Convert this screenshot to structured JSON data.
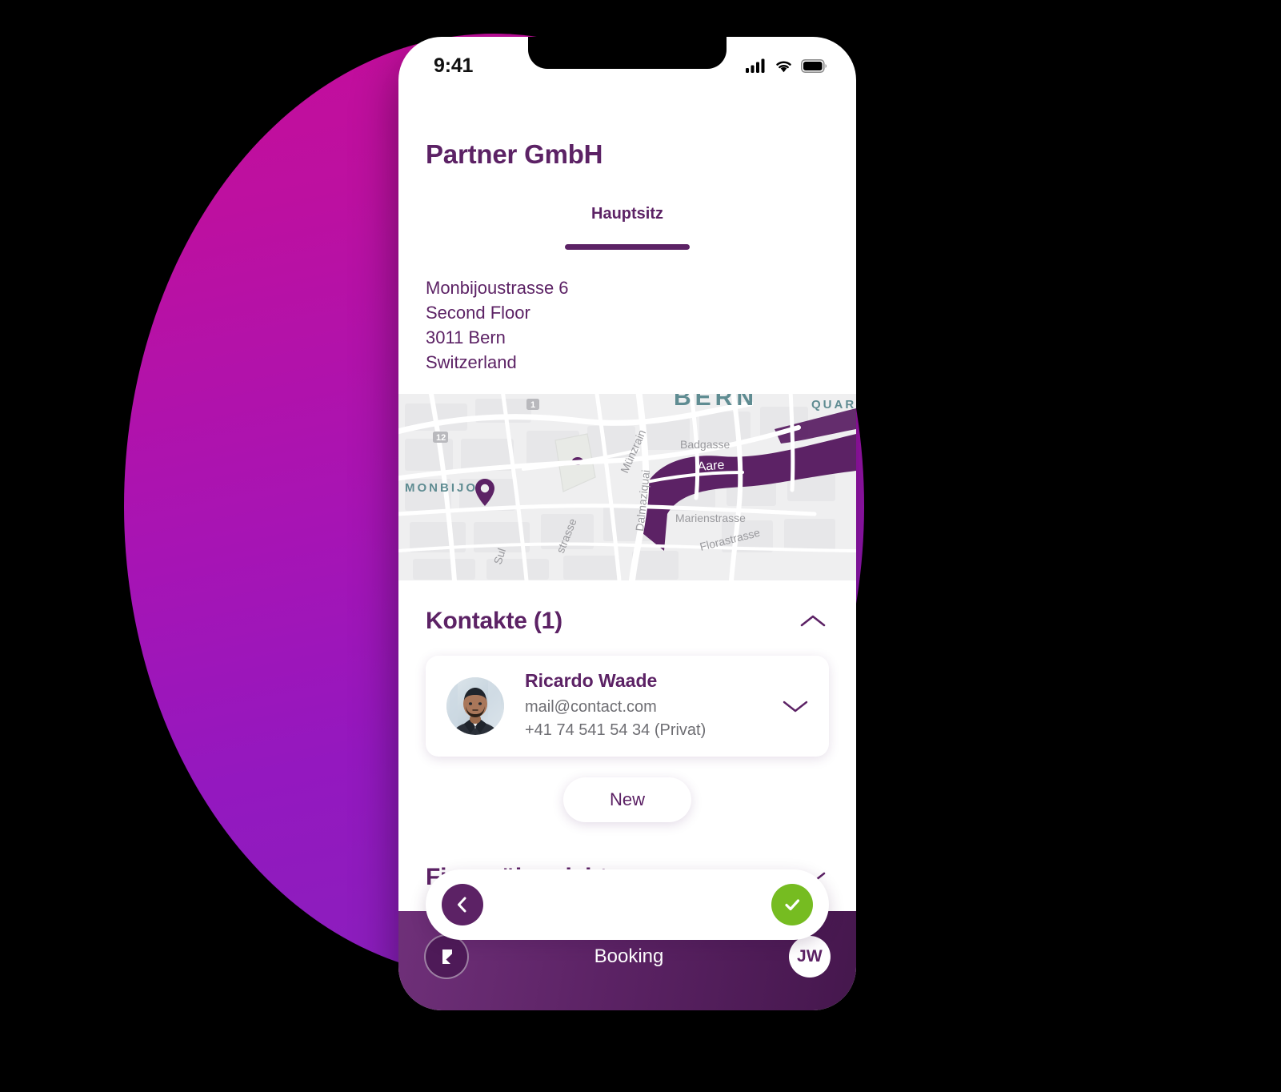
{
  "status_bar": {
    "time": "9:41",
    "icons": [
      "cellular-signal-icon",
      "wifi-icon",
      "battery-icon"
    ]
  },
  "header": {
    "title": "Partner GmbH"
  },
  "tabs": [
    {
      "label": "Hauptsitz",
      "active": true
    }
  ],
  "address": {
    "lines": [
      "Monbijoustrasse 6",
      "Second Floor",
      "3011 Bern",
      "Switzerland"
    ]
  },
  "map": {
    "pin_icon": "map-pin-icon",
    "labels": {
      "city": "BERN",
      "quarter": "QUARTIER",
      "neighbourhood": "MONBIJOU",
      "water": "Aare",
      "streets": [
        "Badgasse",
        "Marienstrasse",
        "Florastrasse",
        "Münzrain",
        "Dalmaziquai",
        "Sulgeneckstrasse",
        "Seilerstrasse"
      ],
      "shields": [
        "1",
        "12"
      ]
    },
    "colors": {
      "land": "#efeff0",
      "block": "#e6e6e8",
      "road": "#ffffff",
      "water": "#5c2265",
      "label": "#5f8c92"
    }
  },
  "sections": [
    {
      "id": "kontakte",
      "title": "Kontakte (1)",
      "expanded": true,
      "chevron_icon": "chevron-up-icon"
    },
    {
      "id": "finanzuebersicht",
      "title": "Finanzübersicht",
      "expanded": false,
      "chevron_icon": "chevron-down-icon"
    }
  ],
  "contacts": [
    {
      "name": "Ricardo Waade",
      "email": "mail@contact.com",
      "phone": "+41 74 541 54 34 (Privat)",
      "avatar_icon": "contact-photo",
      "expand_icon": "chevron-down-icon"
    }
  ],
  "buttons": {
    "new_label": "New",
    "back_icon": "chevron-left-icon",
    "confirm_icon": "check-icon"
  },
  "bottom_nav": {
    "logo_icon": "brand-logo-icon",
    "label": "Booking",
    "avatar_initials": "JW"
  },
  "colors": {
    "brand_purple": "#5c2265",
    "magenta": "#c50d9b",
    "violet": "#8721bd",
    "green": "#76bc21",
    "grey_text": "#6e6e73"
  }
}
